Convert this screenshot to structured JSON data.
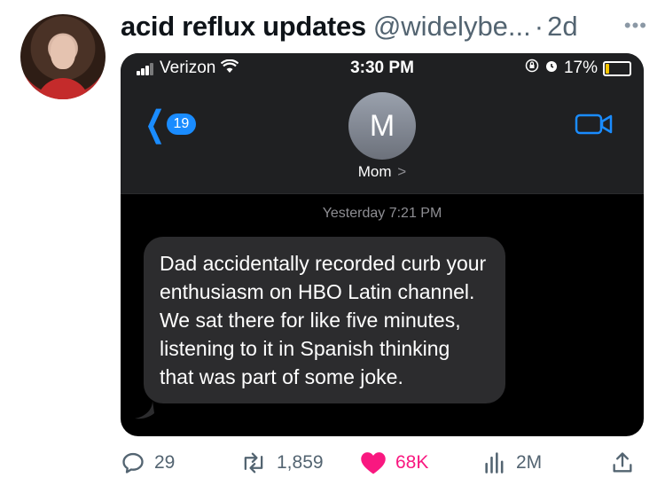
{
  "tweet": {
    "display_name": "acid reflux updates",
    "handle": "@widelybe...",
    "separator": "·",
    "time": "2d",
    "more": "•••"
  },
  "phone": {
    "status": {
      "carrier": "Verizon",
      "time": "3:30 PM",
      "battery": "17%",
      "battery_level": 0.17
    },
    "back_badge": "19",
    "contact_initial": "M",
    "contact_name": "Mom",
    "contact_arrow": ">",
    "timestamp": "Yesterday 7:21 PM",
    "message": "Dad accidentally recorded curb your enthusiasm on HBO Latin channel. We sat there for like five minutes, listening to it in Spanish thinking that was part of some joke."
  },
  "actions": {
    "replies": "29",
    "retweets": "1,859",
    "likes": "68K",
    "views": "2M"
  },
  "colors": {
    "like": "#f91880",
    "ios_blue": "#1a8cff",
    "bubble": "#2c2c2e"
  }
}
